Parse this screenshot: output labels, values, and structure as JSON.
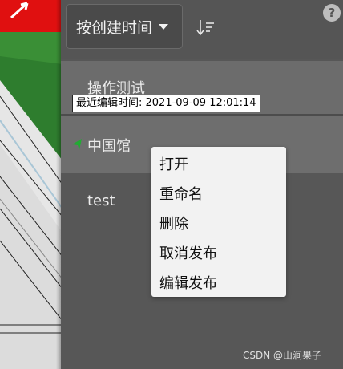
{
  "toolbar": {
    "sort_select_value": "按创建时间",
    "sort_order_icon": "sort-descending-icon",
    "help_label": "?"
  },
  "list": {
    "items": [
      {
        "label": "操作测试"
      },
      {
        "label": "中国馆",
        "status_icon": "published-flag-icon",
        "status_color": "#22aa33"
      },
      {
        "label": "test"
      }
    ],
    "tooltip": "最近编辑时间: 2021-09-09 12:01:14"
  },
  "context_menu": {
    "items": [
      "打开",
      "重命名",
      "删除",
      "取消发布",
      "编辑发布"
    ]
  },
  "watermark": "CSDN @山涧果子",
  "colors": {
    "panel_bg": "#575757",
    "selected_row": "#6e6e6e",
    "menu_bg": "#f2f2f2",
    "flag": "#22aa33"
  }
}
